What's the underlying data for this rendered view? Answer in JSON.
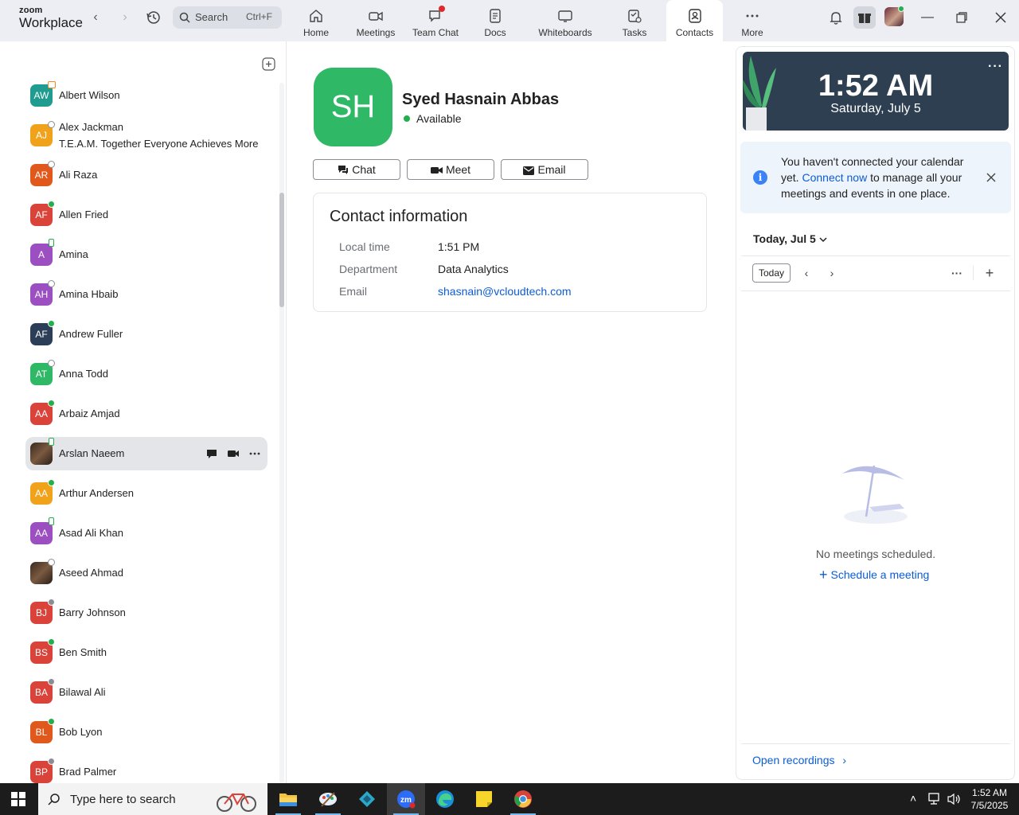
{
  "app": {
    "brand_small": "zoom",
    "brand_large": "Workplace"
  },
  "search": {
    "label": "Search",
    "shortcut": "Ctrl+F"
  },
  "tabs": [
    {
      "label": "Home",
      "icon": "home-icon"
    },
    {
      "label": "Meetings",
      "icon": "video-icon"
    },
    {
      "label": "Team Chat",
      "icon": "chat-icon"
    },
    {
      "label": "Docs",
      "icon": "doc-icon"
    },
    {
      "label": "Whiteboards",
      "icon": "whiteboard-icon"
    },
    {
      "label": "Tasks",
      "icon": "tasks-icon"
    },
    {
      "label": "Contacts",
      "icon": "contacts-icon",
      "active": true
    },
    {
      "label": "More",
      "icon": "more-icon"
    }
  ],
  "contacts": [
    {
      "initials": "AW",
      "name": "Albert Wilson",
      "color": "#1f9b8f",
      "presence": "cal"
    },
    {
      "initials": "AJ",
      "name": "Alex Jackman",
      "subtitle": "T.E.A.M. Together Everyone Achieves More",
      "color": "#f0a21b",
      "presence": "off"
    },
    {
      "initials": "AR",
      "name": "Ali Raza",
      "color": "#e0581c",
      "presence": "off"
    },
    {
      "initials": "AF",
      "name": "Allen Fried",
      "color": "#d9433a",
      "presence": "on"
    },
    {
      "initials": "A",
      "name": "Amina",
      "color": "#9b4fc0",
      "presence": "mob"
    },
    {
      "initials": "AH",
      "name": "Amina Hbaib",
      "color": "#9b4fc0",
      "presence": "off"
    },
    {
      "initials": "AF",
      "name": "Andrew Fuller",
      "color": "#2c3e57",
      "presence": "on"
    },
    {
      "initials": "AT",
      "name": "Anna Todd",
      "color": "#2fb865",
      "presence": "off"
    },
    {
      "initials": "AA",
      "name": "Arbaiz Amjad",
      "color": "#d9433a",
      "presence": "on"
    },
    {
      "initials": "",
      "name": "Arslan Naeem",
      "color": "#3a2a20",
      "presence": "mob",
      "photo": true,
      "selected": true
    },
    {
      "initials": "AA",
      "name": "Arthur Andersen",
      "color": "#f0a21b",
      "presence": "on"
    },
    {
      "initials": "AA",
      "name": "Asad Ali Khan",
      "color": "#9b4fc0",
      "presence": "mob"
    },
    {
      "initials": "",
      "name": "Aseed Ahmad",
      "color": "#3a2a20",
      "presence": "off",
      "photo": true
    },
    {
      "initials": "BJ",
      "name": "Barry Johnson",
      "color": "#d9433a",
      "presence": "dnd"
    },
    {
      "initials": "BS",
      "name": "Ben Smith",
      "color": "#d9433a",
      "presence": "on"
    },
    {
      "initials": "BA",
      "name": "Bilawal Ali",
      "color": "#d9433a",
      "presence": "dnd"
    },
    {
      "initials": "BL",
      "name": "Bob Lyon",
      "color": "#e0581c",
      "presence": "on"
    },
    {
      "initials": "BP",
      "name": "Brad Palmer",
      "color": "#d9433a",
      "presence": "dnd"
    }
  ],
  "profile": {
    "initials": "SH",
    "name": "Syed Hasnain Abbas",
    "status": "Available",
    "actions": {
      "chat": "Chat",
      "meet": "Meet",
      "email": "Email"
    },
    "info_title": "Contact information",
    "fields": [
      {
        "label": "Local time",
        "value": "1:51 PM"
      },
      {
        "label": "Department",
        "value": "Data Analytics"
      },
      {
        "label": "Email",
        "value": "shasnain@vcloudtech.com"
      }
    ]
  },
  "calendar": {
    "time": "1:52 AM",
    "date": "Saturday, July 5",
    "notice_prefix": "You haven't connected your calendar yet.",
    "notice_link": "Connect now",
    "notice_suffix": "to manage all your meetings and events in one place.",
    "day_title": "Today, Jul 5",
    "today_button": "Today",
    "empty_message": "No meetings scheduled.",
    "schedule_link": "Schedule a meeting",
    "open_recordings": "Open recordings"
  },
  "taskbar": {
    "search_placeholder": "Type here to search",
    "time": "1:52 AM",
    "date": "7/5/2025"
  }
}
